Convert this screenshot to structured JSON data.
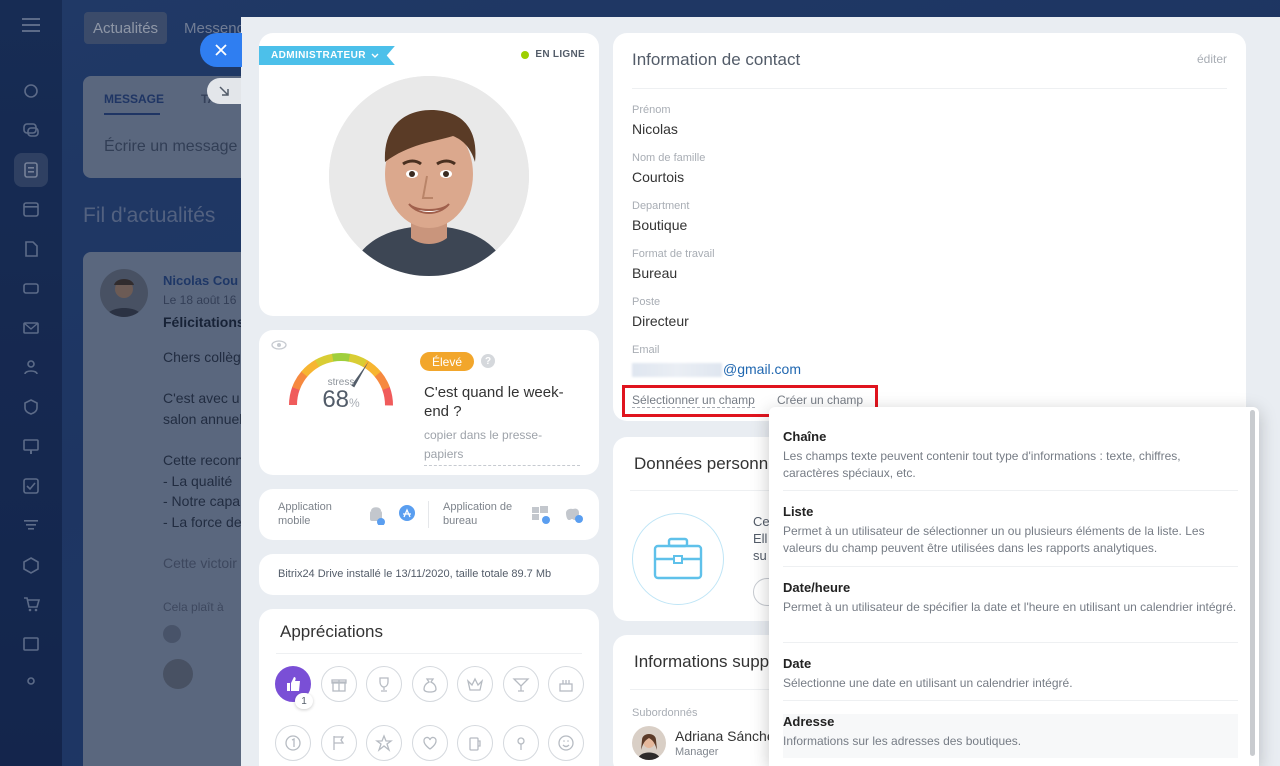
{
  "background": {
    "tabs": [
      "Actualités",
      "Messenger"
    ],
    "composer": {
      "tab_message": "MESSAGE",
      "tab_second": "TA",
      "placeholder": "Écrire un message"
    },
    "feed_title": "Fil d'actualités",
    "post": {
      "author": "Nicolas Cou",
      "date": "Le 18 août 16",
      "title": "Félicitations",
      "lines": [
        "Chers collèg",
        "C'est avec u",
        "salon annuel",
        "Cette reconn",
        "- La qualité",
        "- Notre capa",
        "- La force de",
        "Cette victoir"
      ],
      "like_text": "Cela plaît à"
    }
  },
  "profile": {
    "role_badge": "ADMINISTRATEUR",
    "status": "EN LIGNE"
  },
  "stress": {
    "label": "stress",
    "value": "68",
    "unit": "%",
    "level_badge": "Élevé",
    "quote": "C'est quand le week-end ?",
    "copy_link": "copier dans le presse-papiers",
    "gauge_fraction": 0.68
  },
  "apps": {
    "mobile_label": "Application mobile",
    "desktop_label": "Application de bureau"
  },
  "drive": {
    "text": "Bitrix24 Drive installé le 13/11/2020, taille totale 89.7 Mb"
  },
  "appreciations": {
    "title": "Appréciations",
    "like_count": "1"
  },
  "contact": {
    "title": "Information de contact",
    "edit": "éditer",
    "fields": [
      {
        "label": "Prénom",
        "value": "Nicolas"
      },
      {
        "label": "Nom de famille",
        "value": "Courtois"
      },
      {
        "label": "Department",
        "value": "Boutique"
      },
      {
        "label": "Format de travail",
        "value": "Bureau"
      },
      {
        "label": "Poste",
        "value": "Directeur"
      },
      {
        "label": "Email",
        "value": "@gmail.com"
      }
    ],
    "select_field": "Sélectionner un champ",
    "create_field": "Créer un champ"
  },
  "personal": {
    "title": "Données personne",
    "text_lines": [
      "Ce",
      "Ell",
      "su"
    ]
  },
  "supplementary": {
    "title": "Informations supp",
    "subordinates_label": "Subordonnés",
    "subordinate_name": "Adriana Sánche",
    "subordinate_role": "Manager"
  },
  "field_types": [
    {
      "title": "Chaîne",
      "description": "Les champs texte peuvent contenir tout type d'informations : texte, chiffres, caractères spéciaux, etc."
    },
    {
      "title": "Liste",
      "description": "Permet à un utilisateur de sélectionner un ou plusieurs éléments de la liste. Les valeurs du champ peuvent être utilisées dans les rapports analytiques."
    },
    {
      "title": "Date/heure",
      "description": "Permet à un utilisateur de spécifier la date et l'heure en utilisant un calendrier intégré."
    },
    {
      "title": "Date",
      "description": "Sélectionne une date en utilisant un calendrier intégré."
    },
    {
      "title": "Adresse",
      "description": "Informations sur les adresses des boutiques."
    }
  ]
}
